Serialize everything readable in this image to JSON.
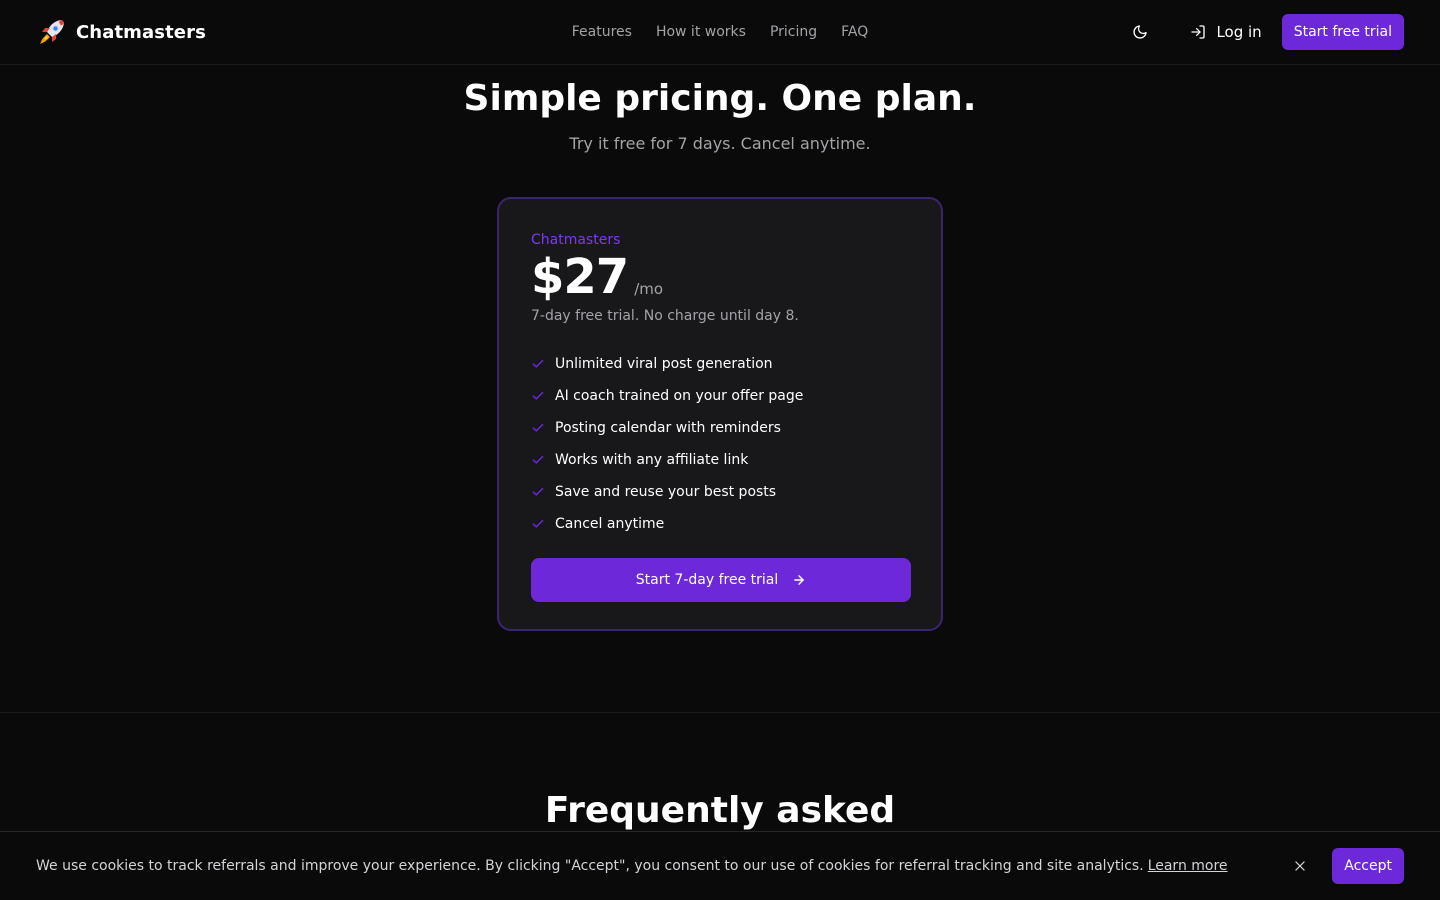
{
  "header": {
    "brand_name": "Chatmasters",
    "logo_icon": "rocket-icon",
    "nav": [
      "Features",
      "How it works",
      "Pricing",
      "FAQ"
    ],
    "theme_icon": "moon-icon",
    "login_label": "Log in",
    "login_icon": "log-in-icon",
    "trial_label": "Start free trial"
  },
  "pricing": {
    "title": "Simple pricing. One plan.",
    "subtitle": "Try it free for 7 days. Cancel anytime.",
    "plan_name": "Chatmasters",
    "price": "$27",
    "period": "/mo",
    "trial_note": "7-day free trial. No charge until day 8.",
    "features": [
      "Unlimited viral post generation",
      "AI coach trained on your offer page",
      "Posting calendar with reminders",
      "Works with any affiliate link",
      "Save and reuse your best posts",
      "Cancel anytime"
    ],
    "cta_label": "Start 7-day free trial",
    "cta_icon": "arrow-right-icon"
  },
  "faq": {
    "title": "Frequently asked"
  },
  "cookie": {
    "text": "We use cookies to track referrals and improve your experience. By clicking \"Accept\", you consent to our use of cookies for referral tracking and site analytics.",
    "link_label": "Learn more",
    "accept_label": "Accept",
    "close_icon": "close-icon"
  },
  "colors": {
    "accent": "#6d28d9",
    "accent_text": "#7c3aed",
    "background": "#0a0a0a",
    "card": "#18181b",
    "muted_text": "#a3a3a8"
  }
}
